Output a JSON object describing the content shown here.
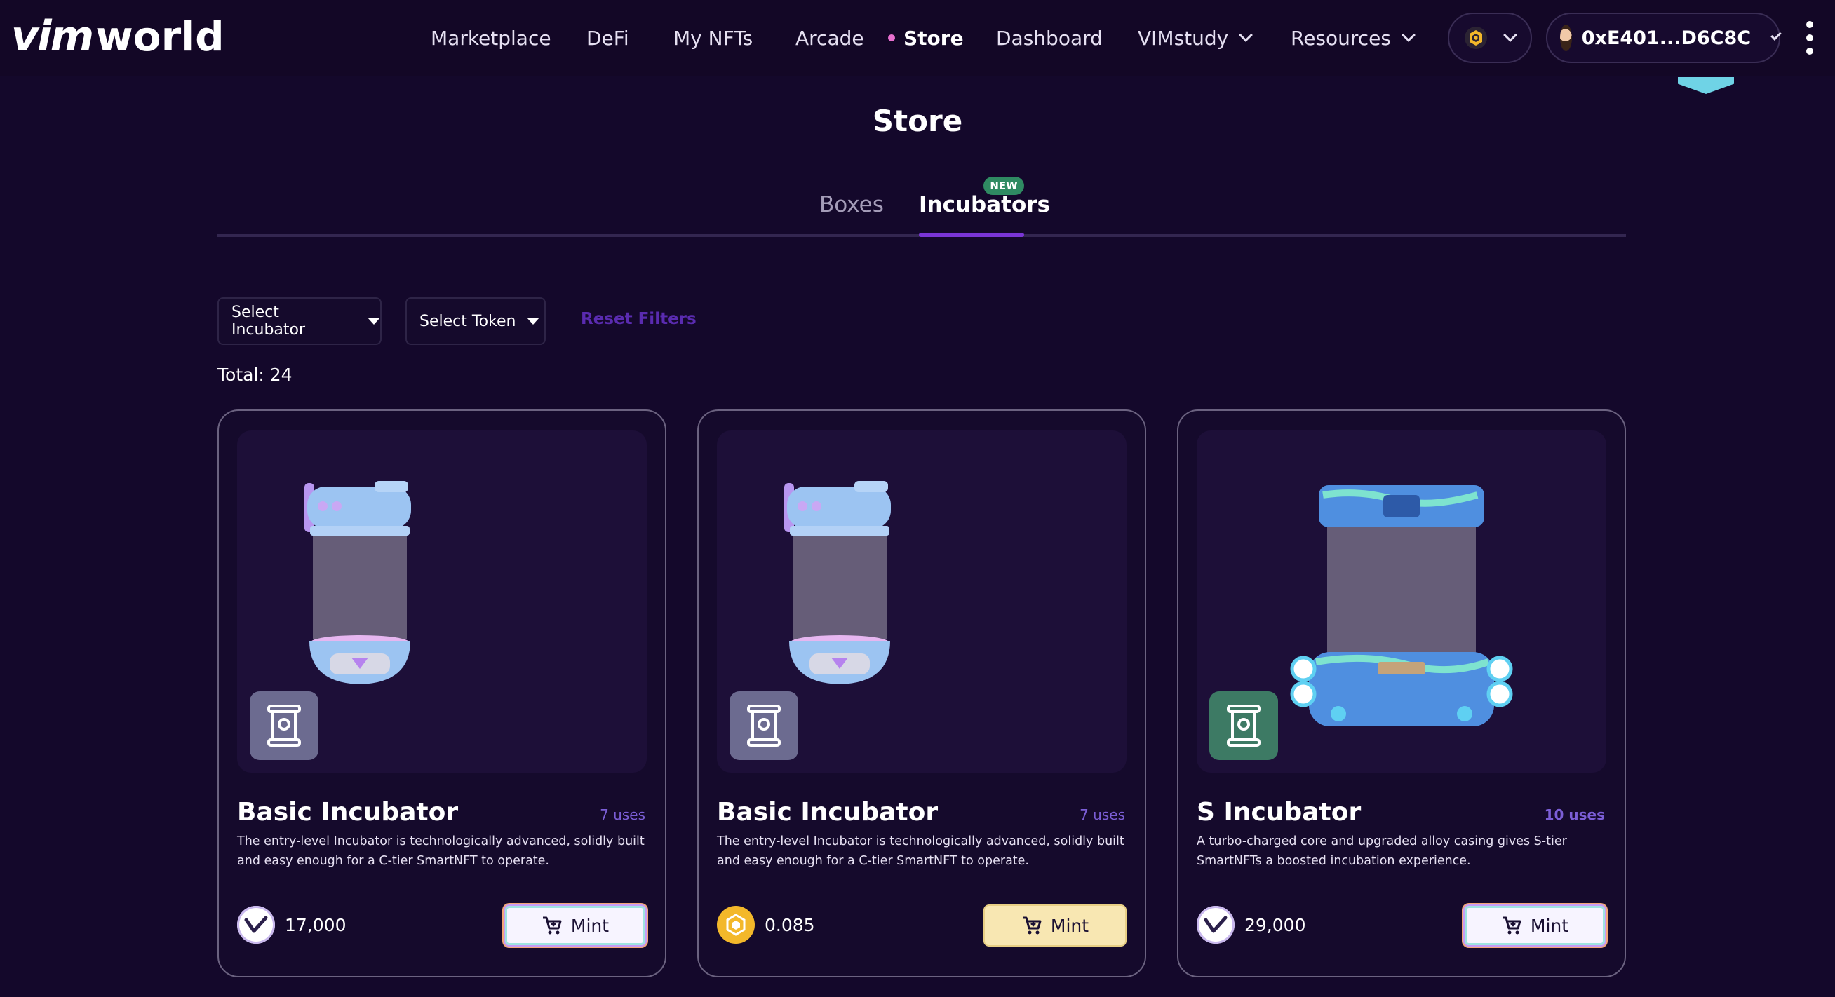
{
  "header": {
    "logo_mark": "vim",
    "logo_text": "world",
    "nav": [
      {
        "label": "Marketplace"
      },
      {
        "label": "DeFi"
      },
      {
        "label": "My NFTs"
      },
      {
        "label": "Arcade"
      },
      {
        "label": "Store",
        "active": true
      },
      {
        "label": "Dashboard"
      },
      {
        "label": "VIMstudy",
        "dropdown": true
      },
      {
        "label": "Resources",
        "dropdown": true
      }
    ],
    "chain_icon": "bnb-chain-icon",
    "wallet_address": "0xE401...D6C8C"
  },
  "page": {
    "title": "Store",
    "tabs": [
      {
        "label": "Boxes",
        "active": false
      },
      {
        "label": "Incubators",
        "active": true,
        "badge": "NEW"
      }
    ],
    "filters": {
      "incubator": "Select Incubator",
      "token": "Select Token",
      "reset": "Reset Filters"
    },
    "total": "Total: 24"
  },
  "cards": [
    {
      "title": "Basic Incubator",
      "uses": "7 uses",
      "description": "The entry-level Incubator is technologically advanced, solidly built and easy enough for a C-tier SmartNFT to operate.",
      "price": "17,000",
      "token": "vim-token-icon",
      "mint_label": "Mint",
      "badge_color": "#6c6b90"
    },
    {
      "title": "Basic Incubator",
      "uses": "7 uses",
      "description": "The entry-level Incubator is technologically advanced, solidly built and easy enough for a C-tier SmartNFT to operate.",
      "price": "0.085",
      "token": "bnb-token-icon",
      "mint_label": "Mint",
      "badge_color": "#6c6b90"
    },
    {
      "title": "S Incubator",
      "uses": "10 uses",
      "description": "A turbo-charged core and upgraded alloy casing gives S-tier SmartNFTs a boosted incubation experience.",
      "price": "29,000",
      "token": "vim-token-icon",
      "mint_label": "Mint",
      "badge_color": "#3d7a64"
    }
  ],
  "colors": {
    "background": "#14082b",
    "accent": "#7a35d6",
    "uses": "#7b5ed6",
    "new_badge": "#2f8a62"
  }
}
